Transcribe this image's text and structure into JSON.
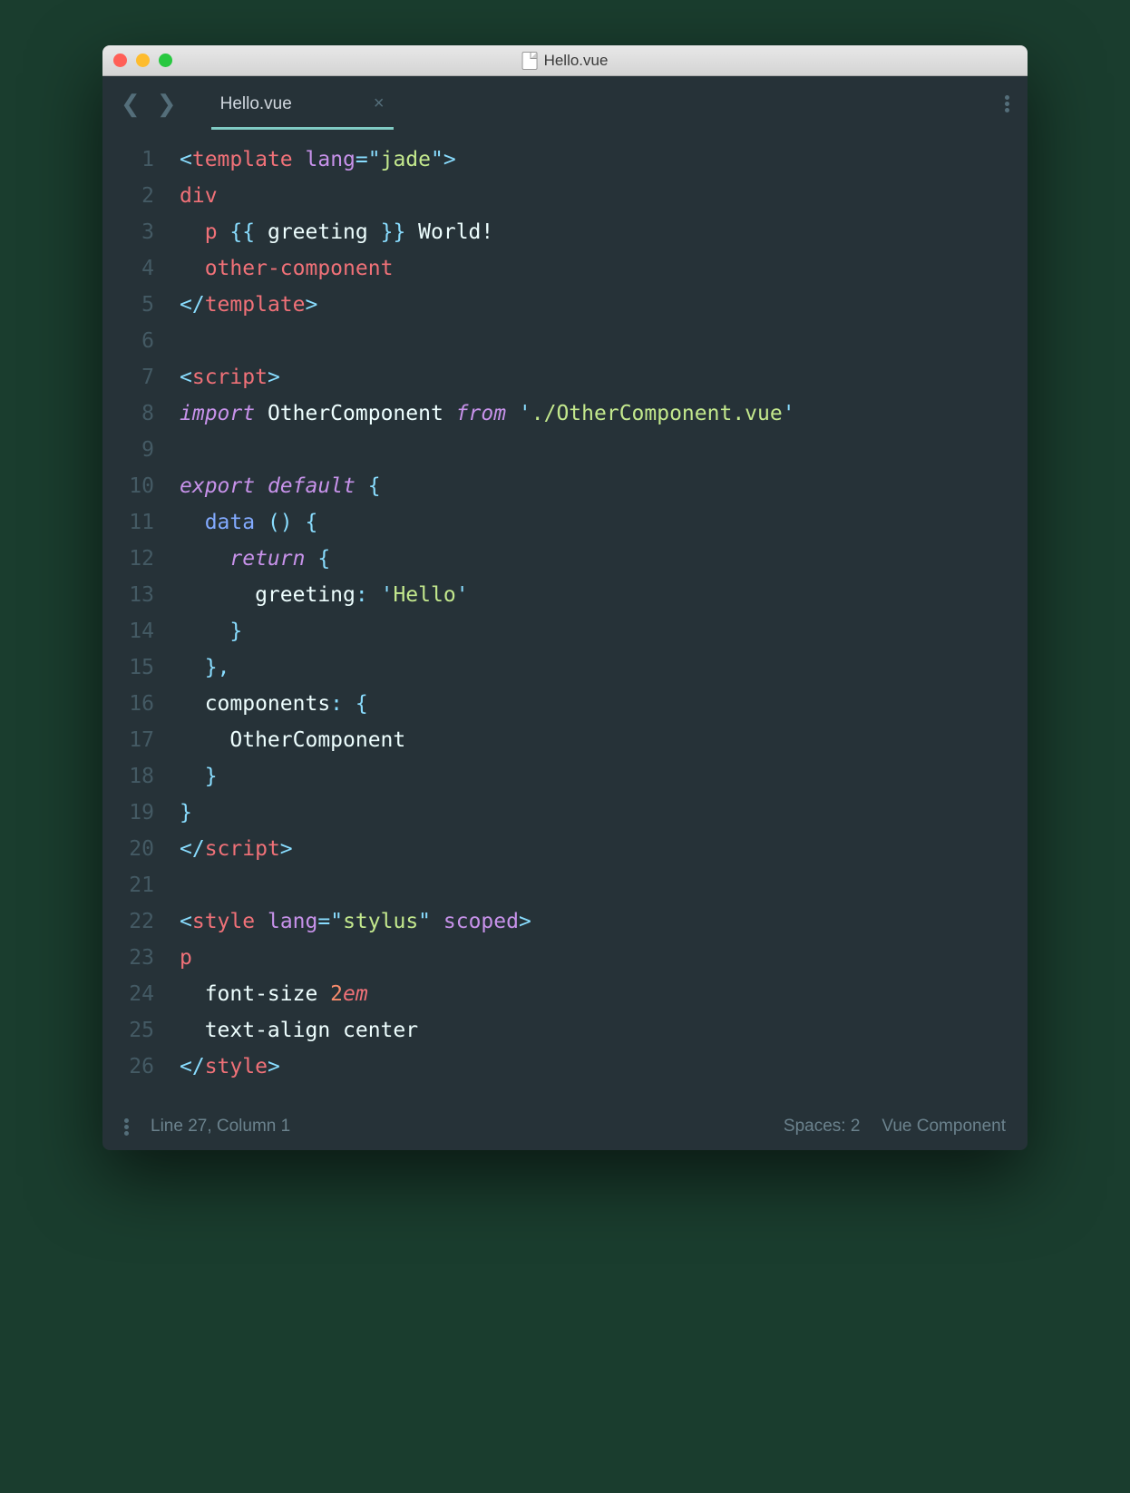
{
  "window": {
    "title": "Hello.vue"
  },
  "tab": {
    "name": "Hello.vue"
  },
  "code": {
    "lines": [
      {
        "n": 1,
        "tokens": [
          [
            "punc",
            "<"
          ],
          [
            "tag",
            "template"
          ],
          [
            "txt",
            " "
          ],
          [
            "attr",
            "lang"
          ],
          [
            "op",
            "="
          ],
          [
            "punc",
            "\""
          ],
          [
            "attrval",
            "jade"
          ],
          [
            "punc",
            "\""
          ],
          [
            "punc",
            ">"
          ]
        ]
      },
      {
        "n": 2,
        "tokens": [
          [
            "tag",
            "div"
          ]
        ]
      },
      {
        "n": 3,
        "tokens": [
          [
            "txt",
            "  "
          ],
          [
            "tag",
            "p"
          ],
          [
            "txt",
            " "
          ],
          [
            "punc",
            "{{"
          ],
          [
            "txt",
            " greeting "
          ],
          [
            "punc",
            "}}"
          ],
          [
            "txt",
            " World!"
          ]
        ]
      },
      {
        "n": 4,
        "tokens": [
          [
            "txt",
            "  "
          ],
          [
            "tag",
            "other-component"
          ]
        ]
      },
      {
        "n": 5,
        "tokens": [
          [
            "punc",
            "</"
          ],
          [
            "tag",
            "template"
          ],
          [
            "punc",
            ">"
          ]
        ]
      },
      {
        "n": 6,
        "tokens": []
      },
      {
        "n": 7,
        "tokens": [
          [
            "punc",
            "<"
          ],
          [
            "tag",
            "script"
          ],
          [
            "punc",
            ">"
          ]
        ]
      },
      {
        "n": 8,
        "tokens": [
          [
            "kw",
            "import"
          ],
          [
            "txt",
            " OtherComponent "
          ],
          [
            "kw",
            "from"
          ],
          [
            "txt",
            " "
          ],
          [
            "punc",
            "'"
          ],
          [
            "str",
            "./OtherComponent.vue"
          ],
          [
            "punc",
            "'"
          ]
        ]
      },
      {
        "n": 9,
        "tokens": []
      },
      {
        "n": 10,
        "tokens": [
          [
            "kw",
            "export"
          ],
          [
            "txt",
            " "
          ],
          [
            "kw",
            "default"
          ],
          [
            "txt",
            " "
          ],
          [
            "punc",
            "{"
          ]
        ]
      },
      {
        "n": 11,
        "tokens": [
          [
            "txt",
            "  "
          ],
          [
            "fn",
            "data"
          ],
          [
            "txt",
            " "
          ],
          [
            "punc",
            "()"
          ],
          [
            "txt",
            " "
          ],
          [
            "punc",
            "{"
          ]
        ]
      },
      {
        "n": 12,
        "tokens": [
          [
            "txt",
            "    "
          ],
          [
            "kw",
            "return"
          ],
          [
            "txt",
            " "
          ],
          [
            "punc",
            "{"
          ]
        ]
      },
      {
        "n": 13,
        "tokens": [
          [
            "txt",
            "      greeting"
          ],
          [
            "op",
            ":"
          ],
          [
            "txt",
            " "
          ],
          [
            "punc",
            "'"
          ],
          [
            "str",
            "Hello"
          ],
          [
            "punc",
            "'"
          ]
        ]
      },
      {
        "n": 14,
        "tokens": [
          [
            "txt",
            "    "
          ],
          [
            "punc",
            "}"
          ]
        ]
      },
      {
        "n": 15,
        "tokens": [
          [
            "txt",
            "  "
          ],
          [
            "punc",
            "}"
          ],
          [
            "op",
            ","
          ]
        ]
      },
      {
        "n": 16,
        "tokens": [
          [
            "txt",
            "  components"
          ],
          [
            "op",
            ":"
          ],
          [
            "txt",
            " "
          ],
          [
            "punc",
            "{"
          ]
        ]
      },
      {
        "n": 17,
        "tokens": [
          [
            "txt",
            "    OtherComponent"
          ]
        ]
      },
      {
        "n": 18,
        "tokens": [
          [
            "txt",
            "  "
          ],
          [
            "punc",
            "}"
          ]
        ]
      },
      {
        "n": 19,
        "tokens": [
          [
            "punc",
            "}"
          ]
        ]
      },
      {
        "n": 20,
        "tokens": [
          [
            "punc",
            "</"
          ],
          [
            "tag",
            "script"
          ],
          [
            "punc",
            ">"
          ]
        ]
      },
      {
        "n": 21,
        "tokens": []
      },
      {
        "n": 22,
        "tokens": [
          [
            "punc",
            "<"
          ],
          [
            "tag",
            "style"
          ],
          [
            "txt",
            " "
          ],
          [
            "attr",
            "lang"
          ],
          [
            "op",
            "="
          ],
          [
            "punc",
            "\""
          ],
          [
            "attrval",
            "stylus"
          ],
          [
            "punc",
            "\""
          ],
          [
            "txt",
            " "
          ],
          [
            "attr",
            "scoped"
          ],
          [
            "punc",
            ">"
          ]
        ]
      },
      {
        "n": 23,
        "tokens": [
          [
            "tag",
            "p"
          ]
        ]
      },
      {
        "n": 24,
        "tokens": [
          [
            "txt",
            "  font-size "
          ],
          [
            "num",
            "2"
          ],
          [
            "unit",
            "em"
          ]
        ]
      },
      {
        "n": 25,
        "tokens": [
          [
            "txt",
            "  text-align center"
          ]
        ]
      },
      {
        "n": 26,
        "tokens": [
          [
            "punc",
            "</"
          ],
          [
            "tag",
            "style"
          ],
          [
            "punc",
            ">"
          ]
        ]
      }
    ]
  },
  "status": {
    "position": "Line 27, Column 1",
    "spaces": "Spaces: 2",
    "syntax": "Vue Component"
  }
}
